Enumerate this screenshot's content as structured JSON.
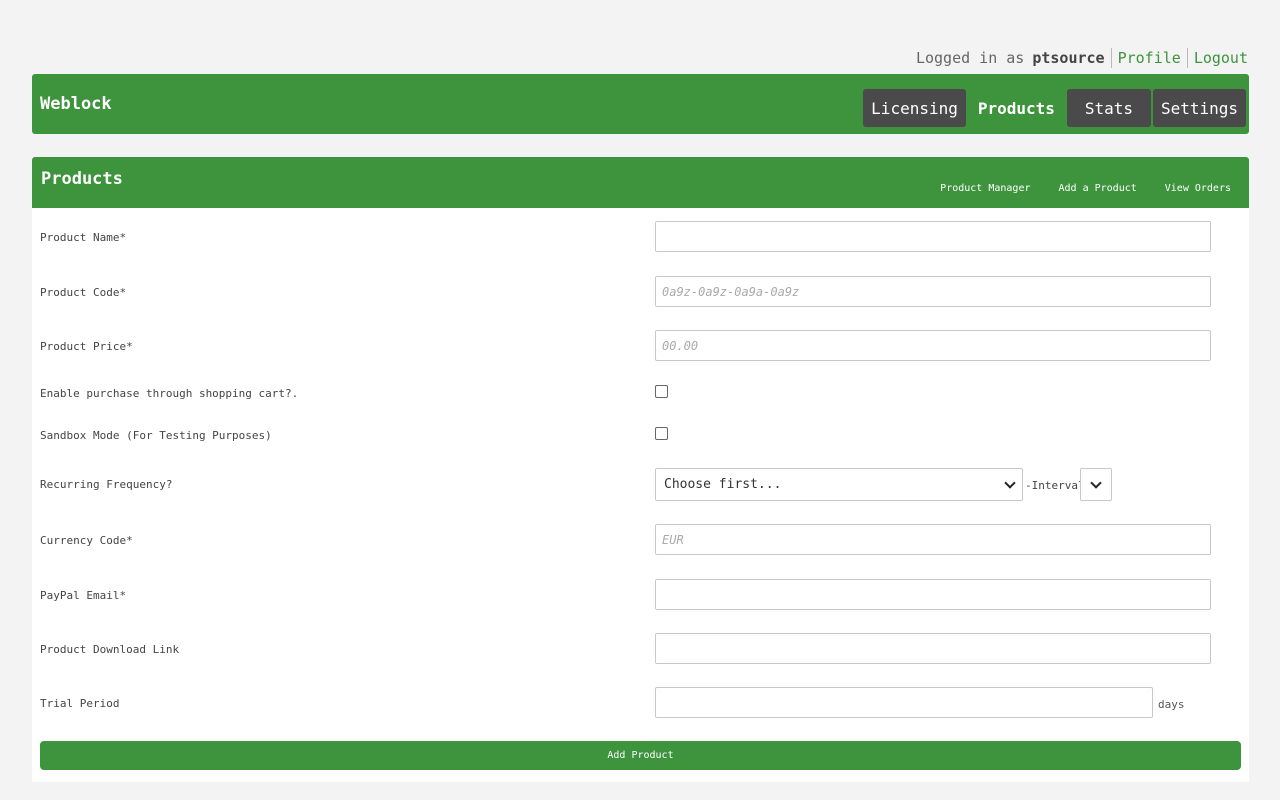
{
  "user_bar": {
    "logged_in_label": "Logged in as",
    "username": "ptsource",
    "profile_link": "Profile",
    "logout_link": "Logout"
  },
  "header": {
    "brand": "Weblock",
    "nav": [
      {
        "label": "Licensing"
      },
      {
        "label": "Products",
        "active": true
      },
      {
        "label": "Stats"
      },
      {
        "label": "Settings"
      }
    ]
  },
  "panel": {
    "title": "Products",
    "links": [
      "Product Manager",
      "Add a Product",
      "View Orders"
    ]
  },
  "form": {
    "product_name": {
      "label": "Product Name*",
      "value": "",
      "placeholder": ""
    },
    "product_code": {
      "label": "Product Code*",
      "value": "",
      "placeholder": "0a9z-0a9z-0a9a-0a9z"
    },
    "product_price": {
      "label": "Product Price*",
      "value": "",
      "placeholder": "00.00"
    },
    "shopping_cart": {
      "label": "Enable purchase through shopping cart?.",
      "checked": false
    },
    "sandbox_mode": {
      "label": "Sandbox Mode (For Testing Purposes)",
      "checked": false
    },
    "recurring": {
      "label": "Recurring Frequency?",
      "selected": "Choose first...",
      "interval_label": "-Interval-",
      "interval_selected": ""
    },
    "currency_code": {
      "label": "Currency Code*",
      "value": "",
      "placeholder": "EUR"
    },
    "paypal_email": {
      "label": "PayPal Email*",
      "value": "",
      "placeholder": ""
    },
    "download_link": {
      "label": "Product Download Link",
      "value": "",
      "placeholder": ""
    },
    "trial_period": {
      "label": "Trial Period",
      "value": "",
      "placeholder": "",
      "unit": "days"
    },
    "submit_label": "Add Product"
  },
  "colors": {
    "brand_green": "#3d943d",
    "nav_dark": "#4a4a4a",
    "page_bg": "#f3f3f3"
  }
}
